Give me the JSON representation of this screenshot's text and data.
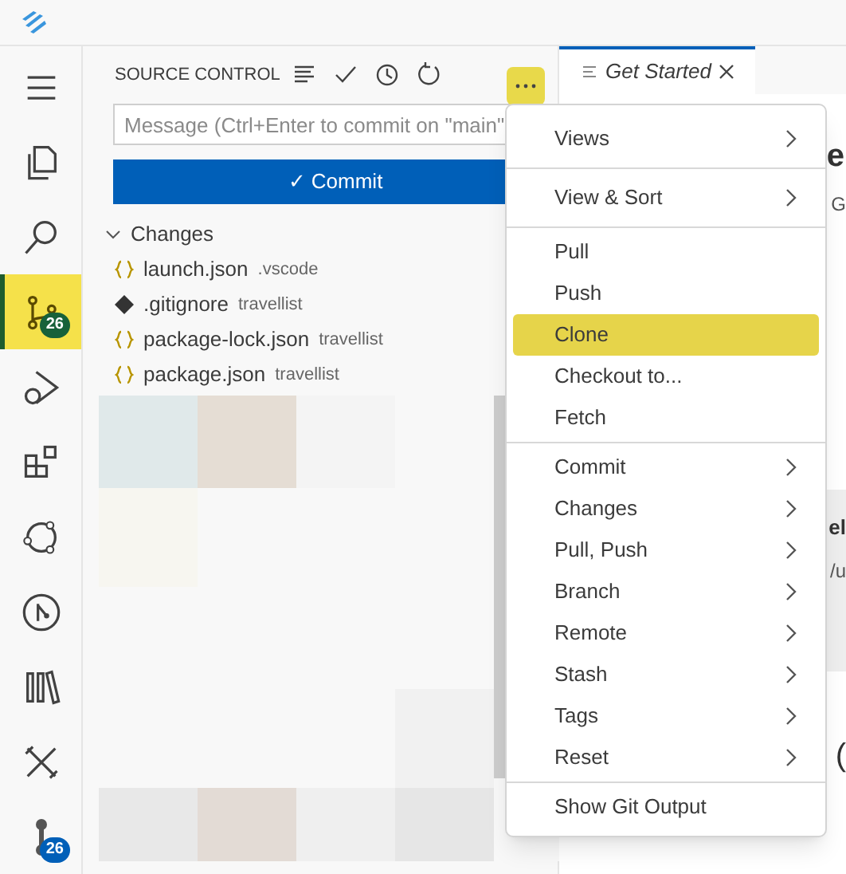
{
  "activity_bar": [
    {
      "kind": "menu",
      "selected": false
    },
    {
      "kind": "explorer",
      "selected": false
    },
    {
      "kind": "search",
      "selected": false
    },
    {
      "kind": "source-control",
      "selected": true,
      "badge": {
        "text": "26",
        "color": "#17613a"
      }
    },
    {
      "kind": "run",
      "selected": false
    },
    {
      "kind": "extensions",
      "selected": false
    },
    {
      "kind": "nodes",
      "selected": false
    },
    {
      "kind": "git-graph",
      "selected": false
    },
    {
      "kind": "library",
      "selected": false
    },
    {
      "kind": "tools",
      "selected": false
    },
    {
      "kind": "branches",
      "selected": false,
      "badge": {
        "text": "26",
        "color": "#005fb8"
      }
    }
  ],
  "panel": {
    "title": "SOURCE CONTROL",
    "more_selected": true,
    "message": {
      "placeholder": "Message (Ctrl+Enter to commit on \"main\""
    },
    "commit_button": "✓ Commit",
    "section": {
      "label": "Changes",
      "expanded": true
    },
    "files": [
      {
        "kind": "json",
        "name": "launch.json",
        "folder": ".vscode"
      },
      {
        "kind": "git",
        "name": ".gitignore",
        "folder": "travellist"
      },
      {
        "kind": "json",
        "name": "package-lock.json",
        "folder": "travellist"
      },
      {
        "kind": "json",
        "name": "package.json",
        "folder": "travellist"
      }
    ]
  },
  "editor": {
    "tab": {
      "label": "Get Started",
      "selected": true
    },
    "fragments": [
      "e",
      "G",
      "el",
      "/u",
      "("
    ]
  },
  "menu": {
    "groups": [
      [
        {
          "label": "Views",
          "submenu": true,
          "selected": false
        }
      ],
      [
        {
          "label": "View & Sort",
          "submenu": true,
          "selected": false
        }
      ],
      [
        {
          "label": "Pull",
          "submenu": false,
          "selected": false
        },
        {
          "label": "Push",
          "submenu": false,
          "selected": false
        },
        {
          "label": "Clone",
          "submenu": false,
          "selected": true
        },
        {
          "label": "Checkout to...",
          "submenu": false,
          "selected": false
        },
        {
          "label": "Fetch",
          "submenu": false,
          "selected": false
        }
      ],
      [
        {
          "label": "Commit",
          "submenu": true,
          "selected": false
        },
        {
          "label": "Changes",
          "submenu": true,
          "selected": false
        },
        {
          "label": "Pull, Push",
          "submenu": true,
          "selected": false
        },
        {
          "label": "Branch",
          "submenu": true,
          "selected": false
        },
        {
          "label": "Remote",
          "submenu": true,
          "selected": false
        },
        {
          "label": "Stash",
          "submenu": true,
          "selected": false
        },
        {
          "label": "Tags",
          "submenu": true,
          "selected": false
        },
        {
          "label": "Reset",
          "submenu": true,
          "selected": false
        }
      ],
      [
        {
          "label": "Show Git Output",
          "submenu": false,
          "selected": false
        }
      ]
    ]
  }
}
